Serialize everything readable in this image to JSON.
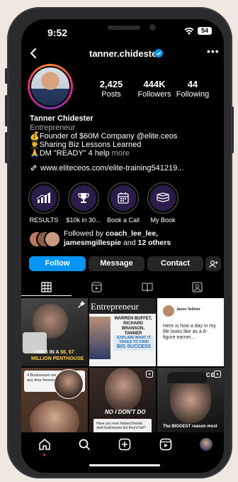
{
  "status": {
    "time": "9:52",
    "battery": "54"
  },
  "profile": {
    "username": "tanner.chidester",
    "display_name": "Tanner Chidester",
    "category": "Entrepreneur",
    "bio_line1": "💰Founder of $60M Company @elite.ceos",
    "bio_line2": "👨‍🎓Sharing Biz Lessons Learned",
    "bio_line3": "🙏DM \"READY\" 4 help",
    "bio_more": "more",
    "link": "www.eliteceos.com/elite-training541219..."
  },
  "stats": [
    {
      "value": "2,425",
      "label": "Posts"
    },
    {
      "value": "444K",
      "label": "Followers"
    },
    {
      "value": "44",
      "label": "Following"
    }
  ],
  "highlights": [
    {
      "label": "RESULTS",
      "icon": "chart-icon"
    },
    {
      "label": "$10k in 30...",
      "icon": "trophy-icon"
    },
    {
      "label": "Book a Call",
      "icon": "calendar-icon"
    },
    {
      "label": "My Book",
      "icon": "book-icon"
    }
  ],
  "followed_by": {
    "prefix": "Followed by ",
    "names": "coach_lee_lee, jamesmgillespie",
    "and": " and ",
    "others": "12 others"
  },
  "buttons": {
    "follow": "Follow",
    "message": "Message",
    "contact": "Contact"
  },
  "tabs": [
    "grid-icon",
    "reels-icon",
    "guide-icon",
    "tagged-icon"
  ],
  "posts": {
    "p1_line1": "I WAS IN A",
    "p1_money": "$6, $7",
    "p1_line2": "MILLION PENTHOUSE",
    "p2_title": "Entrepreneur",
    "p2_names": "WARREN BUFFET, RICHARD BRANSON, TANNER CHIDESTER",
    "p2_box1": "EXPLAIN WHAT IT TAKES TO FIND",
    "p2_box2": "BIG SUCCESS",
    "p3_name": "Jason Vollmer",
    "p3_text": "Here is how a day in my life looks like as a 8-figure earner...",
    "p4_text": "4 Businesses we all can start any time forever",
    "p5_top": "Have you ever helped friends start businesses but they'd fail?",
    "p5_caption": "NO I DON'T DO",
    "p6_brand": "ELITE CE",
    "p6_caption": "The BIGGEST reason most"
  },
  "colors": {
    "accent": "#0095f6",
    "verified": "#0095f6",
    "background": "#000000"
  }
}
